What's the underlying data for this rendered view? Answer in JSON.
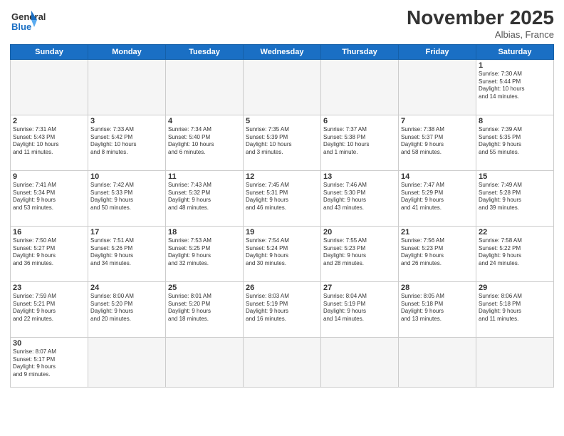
{
  "header": {
    "logo_line1": "General",
    "logo_line2": "Blue",
    "month_title": "November 2025",
    "location": "Albias, France"
  },
  "days_of_week": [
    "Sunday",
    "Monday",
    "Tuesday",
    "Wednesday",
    "Thursday",
    "Friday",
    "Saturday"
  ],
  "weeks": [
    [
      {
        "day": "",
        "text": ""
      },
      {
        "day": "",
        "text": ""
      },
      {
        "day": "",
        "text": ""
      },
      {
        "day": "",
        "text": ""
      },
      {
        "day": "",
        "text": ""
      },
      {
        "day": "",
        "text": ""
      },
      {
        "day": "1",
        "text": "Sunrise: 7:30 AM\nSunset: 5:44 PM\nDaylight: 10 hours\nand 14 minutes."
      }
    ],
    [
      {
        "day": "2",
        "text": "Sunrise: 7:31 AM\nSunset: 5:43 PM\nDaylight: 10 hours\nand 11 minutes."
      },
      {
        "day": "3",
        "text": "Sunrise: 7:33 AM\nSunset: 5:42 PM\nDaylight: 10 hours\nand 8 minutes."
      },
      {
        "day": "4",
        "text": "Sunrise: 7:34 AM\nSunset: 5:40 PM\nDaylight: 10 hours\nand 6 minutes."
      },
      {
        "day": "5",
        "text": "Sunrise: 7:35 AM\nSunset: 5:39 PM\nDaylight: 10 hours\nand 3 minutes."
      },
      {
        "day": "6",
        "text": "Sunrise: 7:37 AM\nSunset: 5:38 PM\nDaylight: 10 hours\nand 1 minute."
      },
      {
        "day": "7",
        "text": "Sunrise: 7:38 AM\nSunset: 5:37 PM\nDaylight: 9 hours\nand 58 minutes."
      },
      {
        "day": "8",
        "text": "Sunrise: 7:39 AM\nSunset: 5:35 PM\nDaylight: 9 hours\nand 55 minutes."
      }
    ],
    [
      {
        "day": "9",
        "text": "Sunrise: 7:41 AM\nSunset: 5:34 PM\nDaylight: 9 hours\nand 53 minutes."
      },
      {
        "day": "10",
        "text": "Sunrise: 7:42 AM\nSunset: 5:33 PM\nDaylight: 9 hours\nand 50 minutes."
      },
      {
        "day": "11",
        "text": "Sunrise: 7:43 AM\nSunset: 5:32 PM\nDaylight: 9 hours\nand 48 minutes."
      },
      {
        "day": "12",
        "text": "Sunrise: 7:45 AM\nSunset: 5:31 PM\nDaylight: 9 hours\nand 46 minutes."
      },
      {
        "day": "13",
        "text": "Sunrise: 7:46 AM\nSunset: 5:30 PM\nDaylight: 9 hours\nand 43 minutes."
      },
      {
        "day": "14",
        "text": "Sunrise: 7:47 AM\nSunset: 5:29 PM\nDaylight: 9 hours\nand 41 minutes."
      },
      {
        "day": "15",
        "text": "Sunrise: 7:49 AM\nSunset: 5:28 PM\nDaylight: 9 hours\nand 39 minutes."
      }
    ],
    [
      {
        "day": "16",
        "text": "Sunrise: 7:50 AM\nSunset: 5:27 PM\nDaylight: 9 hours\nand 36 minutes."
      },
      {
        "day": "17",
        "text": "Sunrise: 7:51 AM\nSunset: 5:26 PM\nDaylight: 9 hours\nand 34 minutes."
      },
      {
        "day": "18",
        "text": "Sunrise: 7:53 AM\nSunset: 5:25 PM\nDaylight: 9 hours\nand 32 minutes."
      },
      {
        "day": "19",
        "text": "Sunrise: 7:54 AM\nSunset: 5:24 PM\nDaylight: 9 hours\nand 30 minutes."
      },
      {
        "day": "20",
        "text": "Sunrise: 7:55 AM\nSunset: 5:23 PM\nDaylight: 9 hours\nand 28 minutes."
      },
      {
        "day": "21",
        "text": "Sunrise: 7:56 AM\nSunset: 5:23 PM\nDaylight: 9 hours\nand 26 minutes."
      },
      {
        "day": "22",
        "text": "Sunrise: 7:58 AM\nSunset: 5:22 PM\nDaylight: 9 hours\nand 24 minutes."
      }
    ],
    [
      {
        "day": "23",
        "text": "Sunrise: 7:59 AM\nSunset: 5:21 PM\nDaylight: 9 hours\nand 22 minutes."
      },
      {
        "day": "24",
        "text": "Sunrise: 8:00 AM\nSunset: 5:20 PM\nDaylight: 9 hours\nand 20 minutes."
      },
      {
        "day": "25",
        "text": "Sunrise: 8:01 AM\nSunset: 5:20 PM\nDaylight: 9 hours\nand 18 minutes."
      },
      {
        "day": "26",
        "text": "Sunrise: 8:03 AM\nSunset: 5:19 PM\nDaylight: 9 hours\nand 16 minutes."
      },
      {
        "day": "27",
        "text": "Sunrise: 8:04 AM\nSunset: 5:19 PM\nDaylight: 9 hours\nand 14 minutes."
      },
      {
        "day": "28",
        "text": "Sunrise: 8:05 AM\nSunset: 5:18 PM\nDaylight: 9 hours\nand 13 minutes."
      },
      {
        "day": "29",
        "text": "Sunrise: 8:06 AM\nSunset: 5:18 PM\nDaylight: 9 hours\nand 11 minutes."
      }
    ],
    [
      {
        "day": "30",
        "text": "Sunrise: 8:07 AM\nSunset: 5:17 PM\nDaylight: 9 hours\nand 9 minutes."
      },
      {
        "day": "",
        "text": ""
      },
      {
        "day": "",
        "text": ""
      },
      {
        "day": "",
        "text": ""
      },
      {
        "day": "",
        "text": ""
      },
      {
        "day": "",
        "text": ""
      },
      {
        "day": "",
        "text": ""
      }
    ]
  ]
}
